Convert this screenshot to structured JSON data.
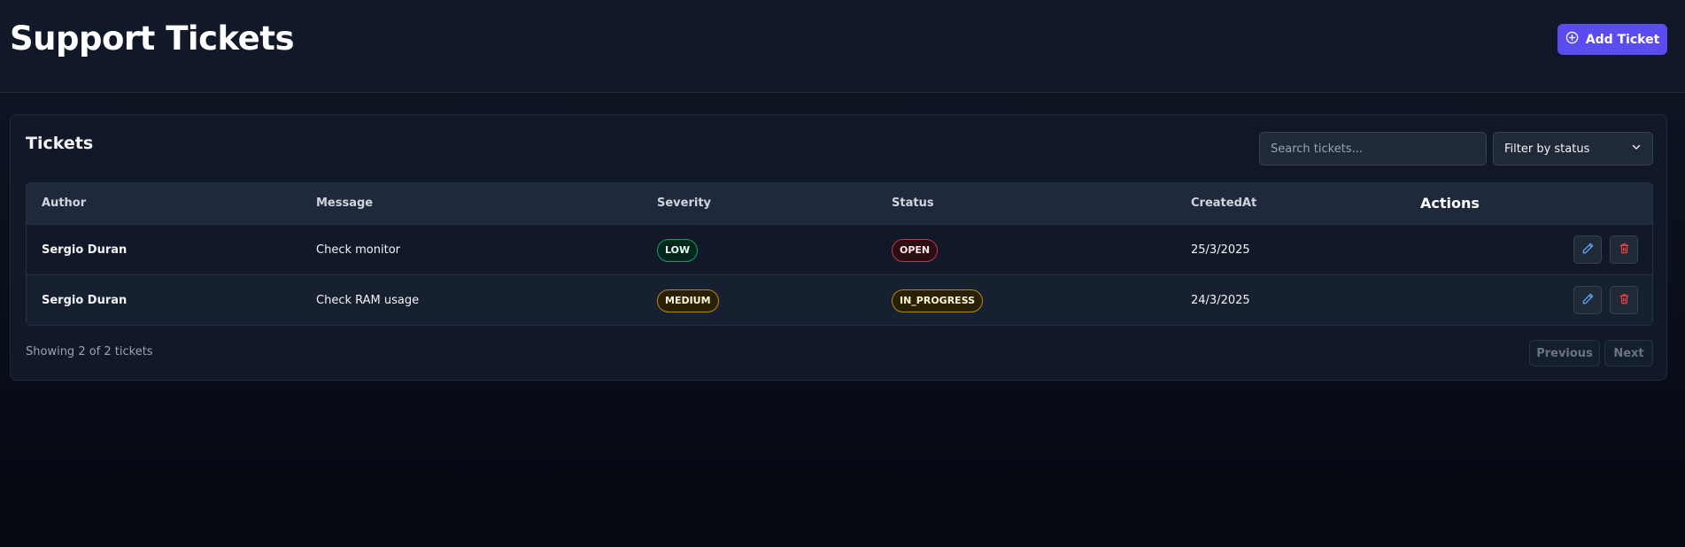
{
  "header": {
    "title": "Support Tickets",
    "add_button_label": "Add Ticket"
  },
  "card": {
    "title": "Tickets",
    "search_placeholder": "Search tickets...",
    "filter_label": "Filter by status"
  },
  "table": {
    "columns": [
      "Author",
      "Message",
      "Severity",
      "Status",
      "CreatedAt",
      "Actions"
    ],
    "rows": [
      {
        "author": "Sergio Duran",
        "message": "Check monitor",
        "severity": "LOW",
        "status": "OPEN",
        "created_at": "25/3/2025"
      },
      {
        "author": "Sergio Duran",
        "message": "Check RAM usage",
        "severity": "MEDIUM",
        "status": "IN_PROGRESS",
        "created_at": "24/3/2025"
      }
    ]
  },
  "footer": {
    "showing_text": "Showing 2 of 2 tickets",
    "previous_label": "Previous",
    "next_label": "Next"
  },
  "colors": {
    "accent": "#5b4cf0",
    "edit_icon": "#60a5fa",
    "delete_icon": "#ef4444"
  },
  "icons": {
    "add": "plus-circle-icon",
    "filter": "chevron-down-icon",
    "edit": "pencil-icon",
    "delete": "trash-icon"
  }
}
